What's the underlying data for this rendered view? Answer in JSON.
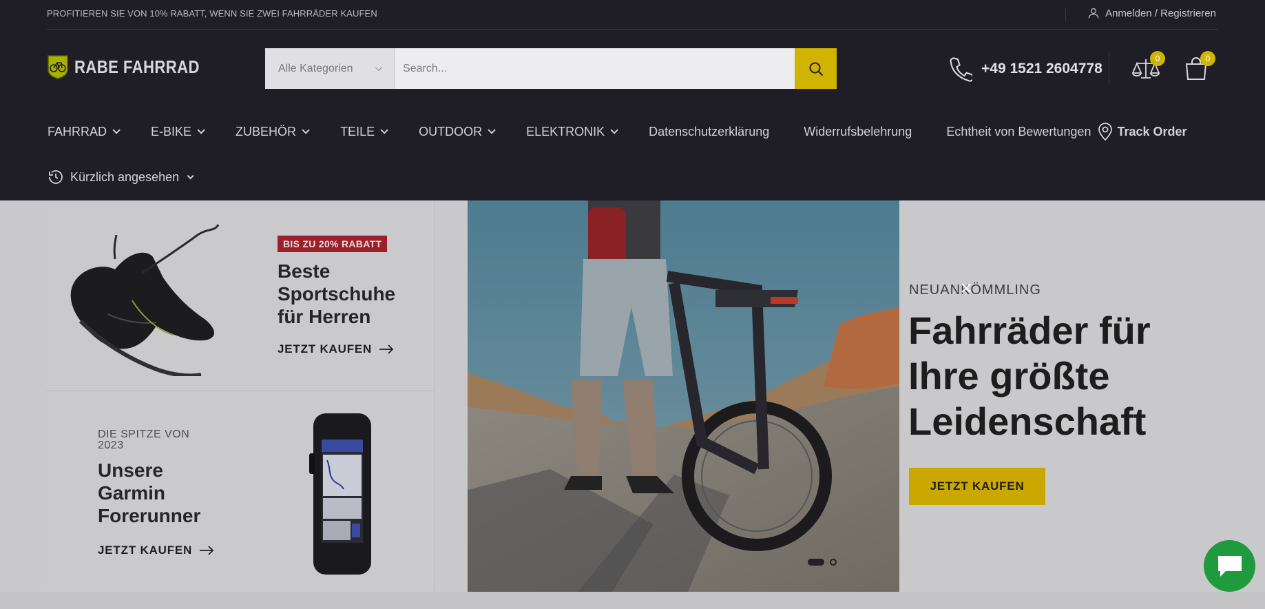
{
  "topbar": {
    "promo": "PROFITIEREN SIE VON 10% RABATT, WENN SIE ZWEI FAHRRÄDER KAUFEN",
    "account": "Anmelden / Registrieren",
    "account_icon": "user-icon"
  },
  "brand": {
    "logo_text": "RABE FAHRRAD",
    "accent": "#d1b400"
  },
  "search": {
    "category": "Alle Kategorien",
    "placeholder": "Search...",
    "button_icon": "search-icon"
  },
  "contact": {
    "phone": "+49 1521 2604778",
    "phone_icon": "phone-icon"
  },
  "header_icons": {
    "compare_count": "0",
    "cart_count": "0"
  },
  "nav": {
    "items": [
      {
        "label": "FAHRRAD"
      },
      {
        "label": "E-BIKE"
      },
      {
        "label": "ZUBEHÖR"
      },
      {
        "label": "TEILE"
      },
      {
        "label": "OUTDOOR"
      },
      {
        "label": "ELEKTRONIK"
      }
    ],
    "links": [
      "Datenschutzerklärung",
      "Widerrufsbelehrung",
      "Echtheit von Bewertungen"
    ],
    "track": "Track Order",
    "recent": "Kürzlich angesehen"
  },
  "promos": {
    "card1": {
      "tag": "BIS ZU 20% RABATT",
      "title_line1": "Beste",
      "title_line2": "Sportschuhe",
      "title_line3": "für Herren",
      "link": "JETZT KAUFEN"
    },
    "card2": {
      "sub_line1": "DIE SPITZE VON",
      "sub_line2": "2023",
      "title_line1": "Unsere",
      "title_line2": "Garmin",
      "title_line3": "Forerunner",
      "link": "JETZT KAUFEN"
    }
  },
  "hero": {
    "eyebrow": "NEUANKÖMMLING",
    "title_line1": "Fahrräder für",
    "title_line2": "Ihre größte",
    "title_line3": "Leidenschaft",
    "button": "JETZT KAUFEN",
    "close": "×"
  }
}
